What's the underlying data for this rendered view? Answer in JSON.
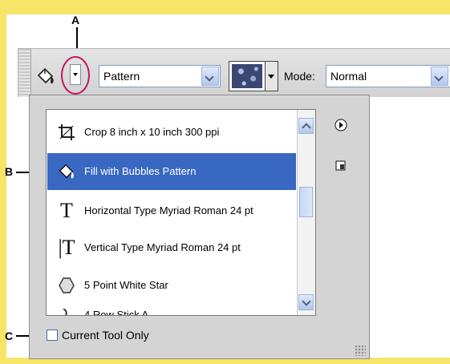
{
  "callouts": {
    "a": "A",
    "b": "B",
    "c": "C"
  },
  "toolbar": {
    "pattern_select": {
      "value": "Pattern"
    },
    "mode_label": "Mode:",
    "mode_select": {
      "value": "Normal"
    }
  },
  "presets": {
    "items": [
      {
        "label": "Crop 8 inch x 10 inch 300 ppi",
        "icon": "crop-icon",
        "selected": false
      },
      {
        "label": "Fill with Bubbles Pattern",
        "icon": "paint-bucket-icon",
        "selected": true
      },
      {
        "label": "Horizontal Type Myriad Roman 24 pt",
        "icon": "horizontal-type-icon",
        "selected": false
      },
      {
        "label": "Vertical Type Myriad Roman 24 pt",
        "icon": "vertical-type-icon",
        "selected": false
      },
      {
        "label": "5 Point White Star",
        "icon": "polygon-icon",
        "selected": false
      },
      {
        "label": "4 Row Stick A...",
        "icon": "partial-tool-icon",
        "selected": false
      }
    ],
    "current_tool_only": {
      "label": "Current Tool Only",
      "checked": false
    }
  },
  "colors": {
    "frame": "#f6e566",
    "selection": "#3868c1",
    "highlight_ring": "#c2185b"
  }
}
